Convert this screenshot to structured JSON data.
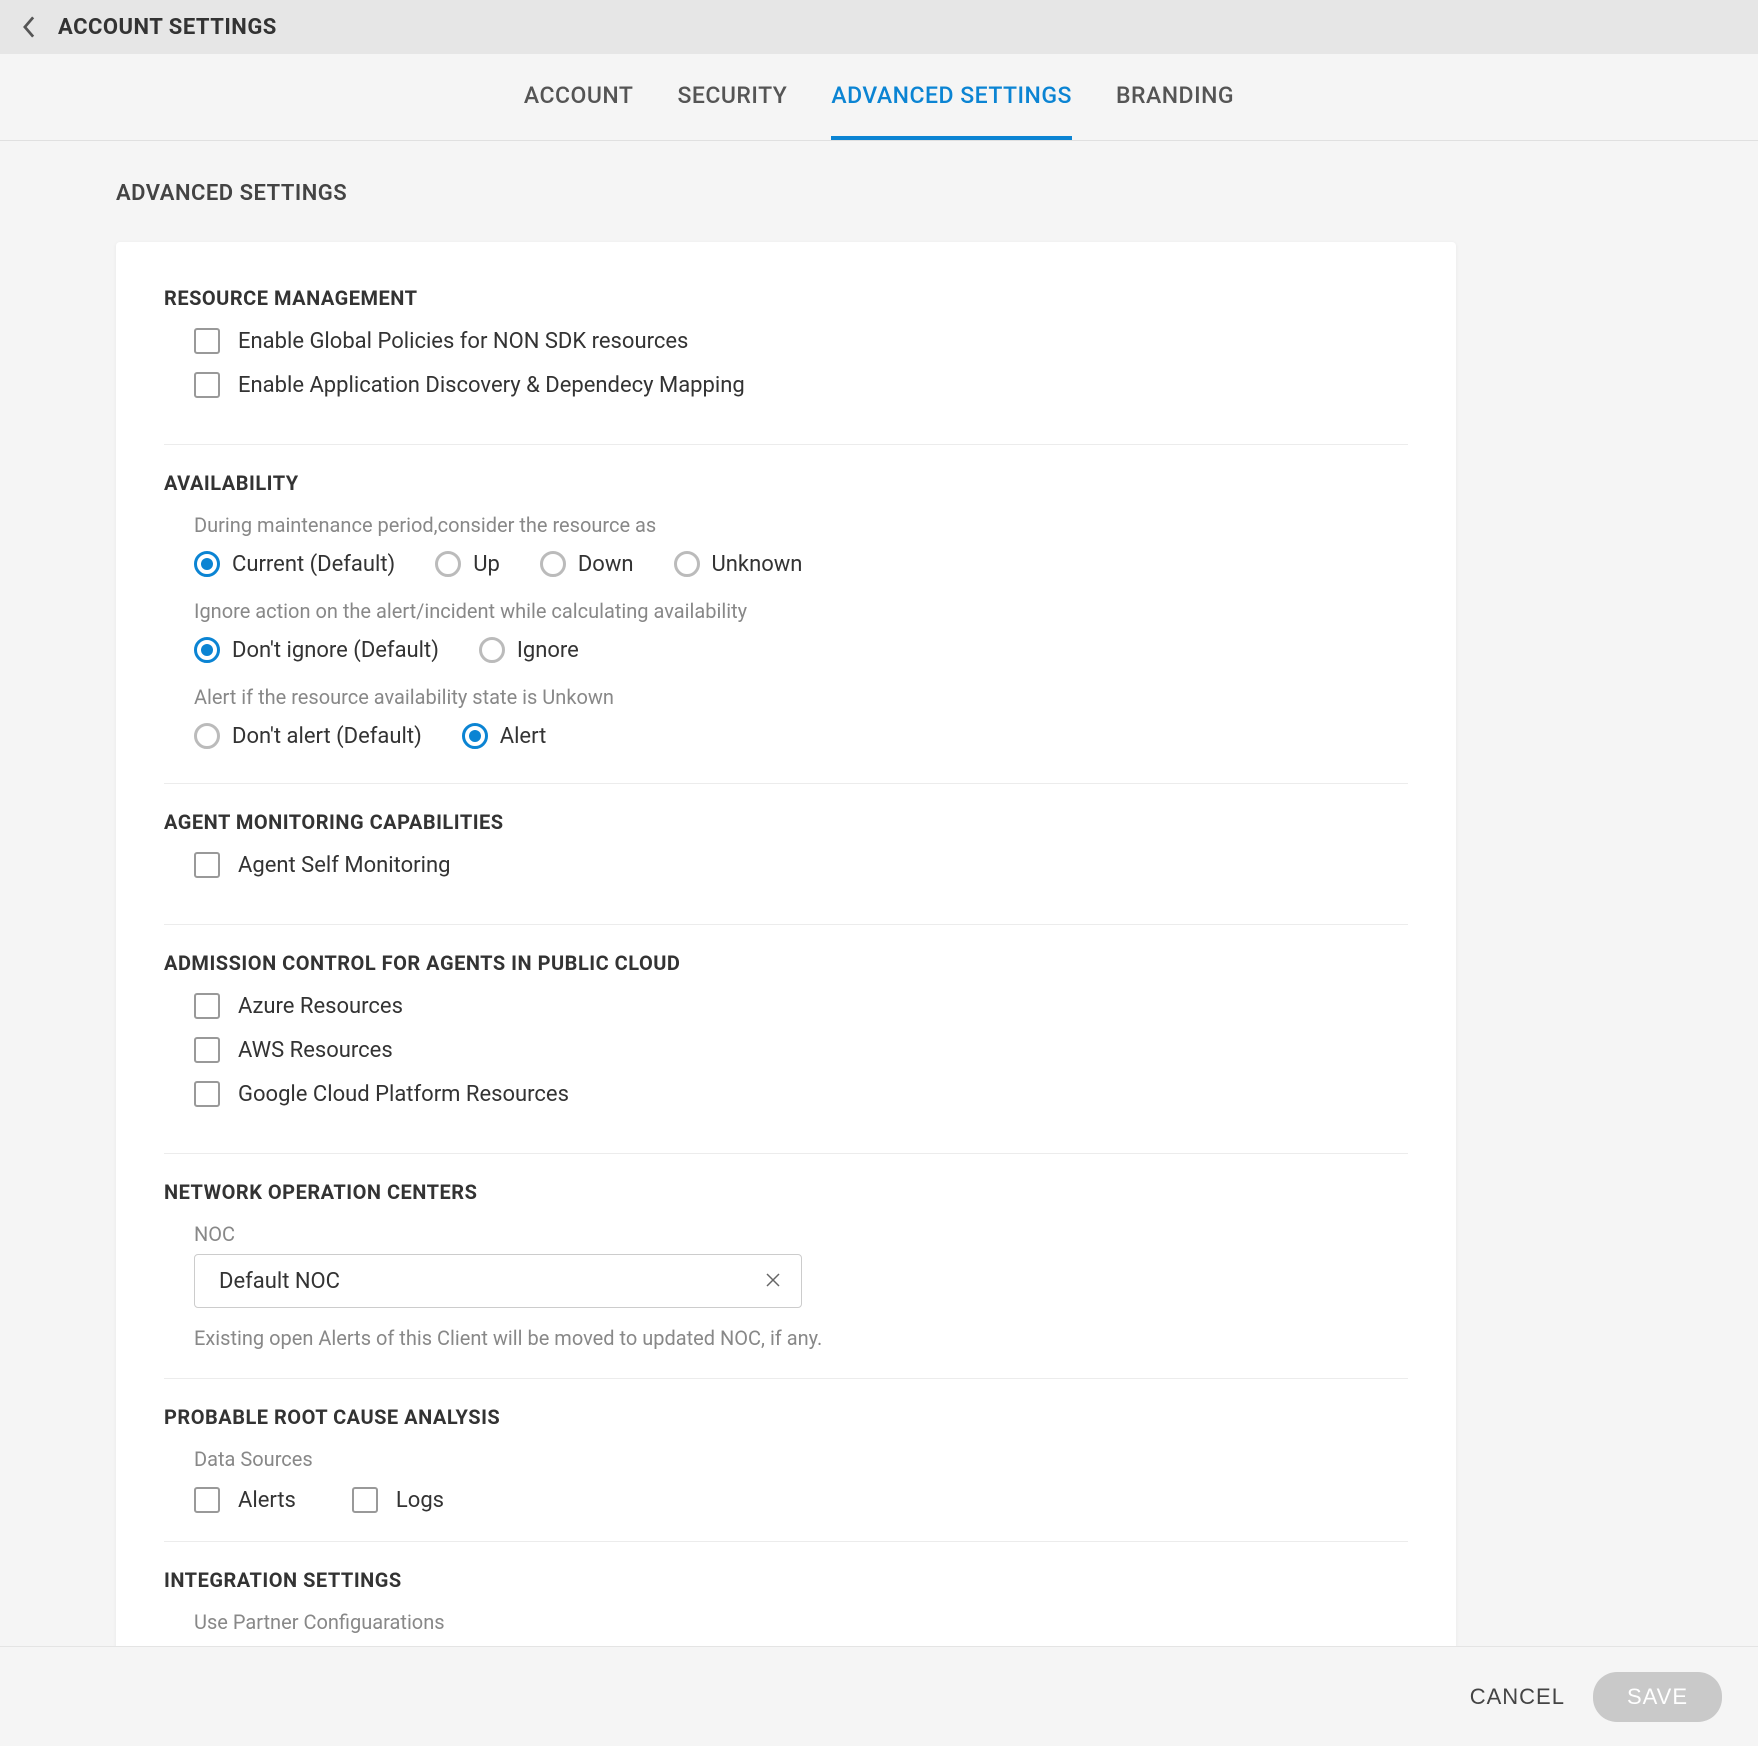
{
  "header": {
    "title": "ACCOUNT SETTINGS"
  },
  "tabs": [
    {
      "label": "ACCOUNT",
      "active": false
    },
    {
      "label": "SECURITY",
      "active": false
    },
    {
      "label": "ADVANCED SETTINGS",
      "active": true
    },
    {
      "label": "BRANDING",
      "active": false
    }
  ],
  "page_subtitle": "ADVANCED SETTINGS",
  "sections": {
    "resource_management": {
      "title": "RESOURCE MANAGEMENT",
      "checks": [
        {
          "label": "Enable Global Policies for NON SDK resources",
          "checked": false
        },
        {
          "label": "Enable Application Discovery & Dependecy Mapping",
          "checked": false
        }
      ]
    },
    "availability": {
      "title": "AVAILABILITY",
      "maintenance_hint": "During maintenance period,consider the resource as",
      "maintenance_options": [
        {
          "label": "Current (Default)",
          "selected": true
        },
        {
          "label": "Up",
          "selected": false
        },
        {
          "label": "Down",
          "selected": false
        },
        {
          "label": "Unknown",
          "selected": false
        }
      ],
      "ignore_hint": "Ignore action on the alert/incident while calculating availability",
      "ignore_options": [
        {
          "label": "Don't ignore (Default)",
          "selected": true
        },
        {
          "label": "Ignore",
          "selected": false
        }
      ],
      "alert_hint": "Alert if the resource availability state is Unkown",
      "alert_options": [
        {
          "label": "Don't alert (Default)",
          "selected": false
        },
        {
          "label": "Alert",
          "selected": true
        }
      ]
    },
    "agent_monitoring": {
      "title": "AGENT MONITORING CAPABILITIES",
      "checks": [
        {
          "label": "Agent Self Monitoring",
          "checked": false
        }
      ]
    },
    "admission_control": {
      "title": "ADMISSION CONTROL FOR AGENTS IN PUBLIC CLOUD",
      "checks": [
        {
          "label": "Azure Resources",
          "checked": false
        },
        {
          "label": "AWS Resources",
          "checked": false
        },
        {
          "label": "Google Cloud Platform Resources",
          "checked": false
        }
      ]
    },
    "noc": {
      "title": "NETWORK OPERATION CENTERS",
      "field_label": "NOC",
      "value": "Default NOC",
      "helper": "Existing open Alerts of this Client will be moved to updated NOC, if any."
    },
    "rca": {
      "title": "PROBABLE ROOT CAUSE ANALYSIS",
      "subtitle": "Data Sources",
      "checks": [
        {
          "label": "Alerts",
          "checked": false
        },
        {
          "label": "Logs",
          "checked": false
        }
      ]
    },
    "integration": {
      "title": "INTEGRATION SETTINGS",
      "helper": "Use Partner Configuarations"
    }
  },
  "footer": {
    "cancel": "CANCEL",
    "save": "SAVE"
  }
}
